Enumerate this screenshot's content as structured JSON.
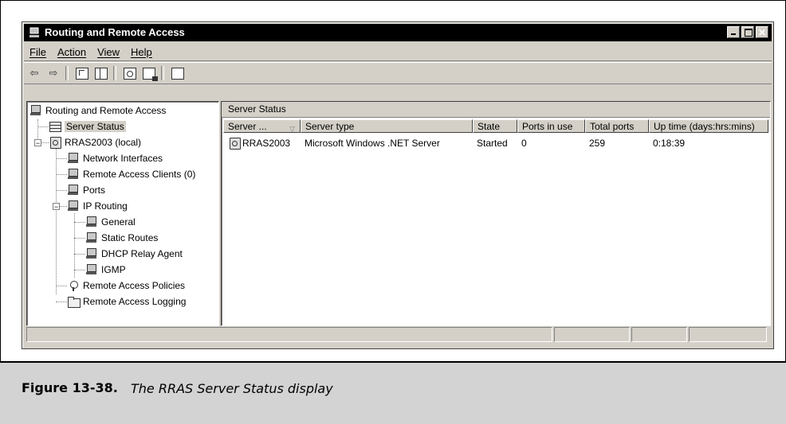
{
  "window": {
    "title": "Routing and Remote Access",
    "close_glyph": "✕"
  },
  "menu": {
    "file": "File",
    "action": "Action",
    "view": "View",
    "help": "Help"
  },
  "toolbar": {
    "back": "⇦",
    "forward": "⇨"
  },
  "tree": {
    "root": "Routing and Remote Access",
    "server_status": "Server Status",
    "server": "RRAS2003 (local)",
    "network_interfaces": "Network Interfaces",
    "remote_access_clients": "Remote Access Clients (0)",
    "ports": "Ports",
    "ip_routing": "IP Routing",
    "general": "General",
    "static_routes": "Static Routes",
    "dhcp_relay_agent": "DHCP Relay Agent",
    "igmp": "IGMP",
    "remote_access_policies": "Remote Access Policies",
    "remote_access_logging": "Remote Access Logging"
  },
  "details": {
    "header": "Server Status",
    "columns": [
      "Server ...",
      "Server type",
      "State",
      "Ports in use",
      "Total ports",
      "Up time (days:hrs:mins)"
    ],
    "rows": [
      [
        "RRAS2003",
        "Microsoft Windows .NET Server",
        "Started",
        "0",
        "259",
        "0:18:39"
      ]
    ]
  },
  "caption": {
    "number": "Figure 13-38.",
    "text": "The RRAS Server Status display"
  }
}
